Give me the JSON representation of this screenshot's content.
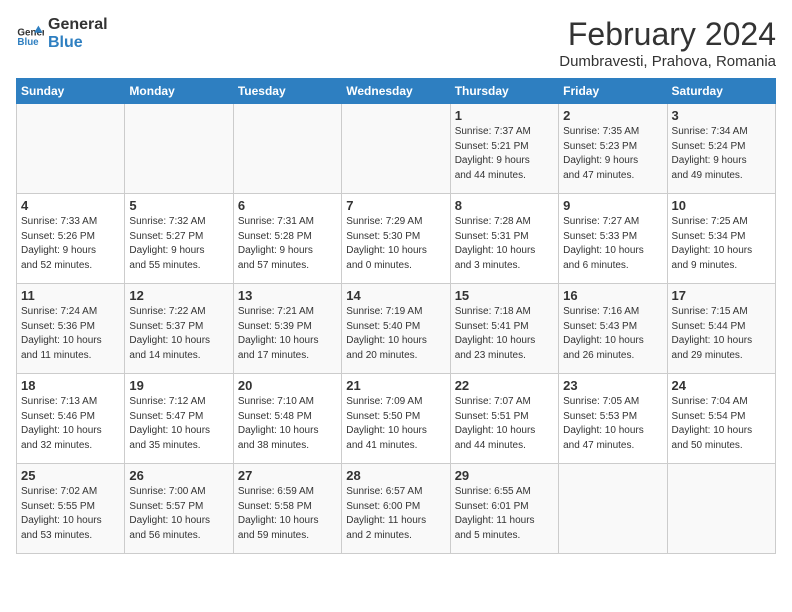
{
  "logo": {
    "line1": "General",
    "line2": "Blue"
  },
  "title": "February 2024",
  "subtitle": "Dumbravesti, Prahova, Romania",
  "days_header": [
    "Sunday",
    "Monday",
    "Tuesday",
    "Wednesday",
    "Thursday",
    "Friday",
    "Saturday"
  ],
  "weeks": [
    [
      {
        "day": "",
        "info": ""
      },
      {
        "day": "",
        "info": ""
      },
      {
        "day": "",
        "info": ""
      },
      {
        "day": "",
        "info": ""
      },
      {
        "day": "1",
        "info": "Sunrise: 7:37 AM\nSunset: 5:21 PM\nDaylight: 9 hours\nand 44 minutes."
      },
      {
        "day": "2",
        "info": "Sunrise: 7:35 AM\nSunset: 5:23 PM\nDaylight: 9 hours\nand 47 minutes."
      },
      {
        "day": "3",
        "info": "Sunrise: 7:34 AM\nSunset: 5:24 PM\nDaylight: 9 hours\nand 49 minutes."
      }
    ],
    [
      {
        "day": "4",
        "info": "Sunrise: 7:33 AM\nSunset: 5:26 PM\nDaylight: 9 hours\nand 52 minutes."
      },
      {
        "day": "5",
        "info": "Sunrise: 7:32 AM\nSunset: 5:27 PM\nDaylight: 9 hours\nand 55 minutes."
      },
      {
        "day": "6",
        "info": "Sunrise: 7:31 AM\nSunset: 5:28 PM\nDaylight: 9 hours\nand 57 minutes."
      },
      {
        "day": "7",
        "info": "Sunrise: 7:29 AM\nSunset: 5:30 PM\nDaylight: 10 hours\nand 0 minutes."
      },
      {
        "day": "8",
        "info": "Sunrise: 7:28 AM\nSunset: 5:31 PM\nDaylight: 10 hours\nand 3 minutes."
      },
      {
        "day": "9",
        "info": "Sunrise: 7:27 AM\nSunset: 5:33 PM\nDaylight: 10 hours\nand 6 minutes."
      },
      {
        "day": "10",
        "info": "Sunrise: 7:25 AM\nSunset: 5:34 PM\nDaylight: 10 hours\nand 9 minutes."
      }
    ],
    [
      {
        "day": "11",
        "info": "Sunrise: 7:24 AM\nSunset: 5:36 PM\nDaylight: 10 hours\nand 11 minutes."
      },
      {
        "day": "12",
        "info": "Sunrise: 7:22 AM\nSunset: 5:37 PM\nDaylight: 10 hours\nand 14 minutes."
      },
      {
        "day": "13",
        "info": "Sunrise: 7:21 AM\nSunset: 5:39 PM\nDaylight: 10 hours\nand 17 minutes."
      },
      {
        "day": "14",
        "info": "Sunrise: 7:19 AM\nSunset: 5:40 PM\nDaylight: 10 hours\nand 20 minutes."
      },
      {
        "day": "15",
        "info": "Sunrise: 7:18 AM\nSunset: 5:41 PM\nDaylight: 10 hours\nand 23 minutes."
      },
      {
        "day": "16",
        "info": "Sunrise: 7:16 AM\nSunset: 5:43 PM\nDaylight: 10 hours\nand 26 minutes."
      },
      {
        "day": "17",
        "info": "Sunrise: 7:15 AM\nSunset: 5:44 PM\nDaylight: 10 hours\nand 29 minutes."
      }
    ],
    [
      {
        "day": "18",
        "info": "Sunrise: 7:13 AM\nSunset: 5:46 PM\nDaylight: 10 hours\nand 32 minutes."
      },
      {
        "day": "19",
        "info": "Sunrise: 7:12 AM\nSunset: 5:47 PM\nDaylight: 10 hours\nand 35 minutes."
      },
      {
        "day": "20",
        "info": "Sunrise: 7:10 AM\nSunset: 5:48 PM\nDaylight: 10 hours\nand 38 minutes."
      },
      {
        "day": "21",
        "info": "Sunrise: 7:09 AM\nSunset: 5:50 PM\nDaylight: 10 hours\nand 41 minutes."
      },
      {
        "day": "22",
        "info": "Sunrise: 7:07 AM\nSunset: 5:51 PM\nDaylight: 10 hours\nand 44 minutes."
      },
      {
        "day": "23",
        "info": "Sunrise: 7:05 AM\nSunset: 5:53 PM\nDaylight: 10 hours\nand 47 minutes."
      },
      {
        "day": "24",
        "info": "Sunrise: 7:04 AM\nSunset: 5:54 PM\nDaylight: 10 hours\nand 50 minutes."
      }
    ],
    [
      {
        "day": "25",
        "info": "Sunrise: 7:02 AM\nSunset: 5:55 PM\nDaylight: 10 hours\nand 53 minutes."
      },
      {
        "day": "26",
        "info": "Sunrise: 7:00 AM\nSunset: 5:57 PM\nDaylight: 10 hours\nand 56 minutes."
      },
      {
        "day": "27",
        "info": "Sunrise: 6:59 AM\nSunset: 5:58 PM\nDaylight: 10 hours\nand 59 minutes."
      },
      {
        "day": "28",
        "info": "Sunrise: 6:57 AM\nSunset: 6:00 PM\nDaylight: 11 hours\nand 2 minutes."
      },
      {
        "day": "29",
        "info": "Sunrise: 6:55 AM\nSunset: 6:01 PM\nDaylight: 11 hours\nand 5 minutes."
      },
      {
        "day": "",
        "info": ""
      },
      {
        "day": "",
        "info": ""
      }
    ]
  ]
}
